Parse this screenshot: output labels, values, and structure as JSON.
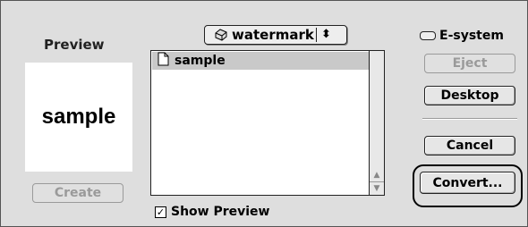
{
  "preview": {
    "title": "Preview",
    "sample_text": "sample",
    "create_label": "Create"
  },
  "folder_popup": {
    "name": "watermark",
    "icon": "disk-icon"
  },
  "files": [
    {
      "name": "sample",
      "icon": "document-icon",
      "selected": true
    }
  ],
  "show_preview": {
    "label": "Show Preview",
    "checked": true
  },
  "volume": {
    "name": "E-system",
    "icon": "drive-icon"
  },
  "buttons": {
    "eject": "Eject",
    "desktop": "Desktop",
    "cancel": "Cancel",
    "convert": "Convert..."
  }
}
